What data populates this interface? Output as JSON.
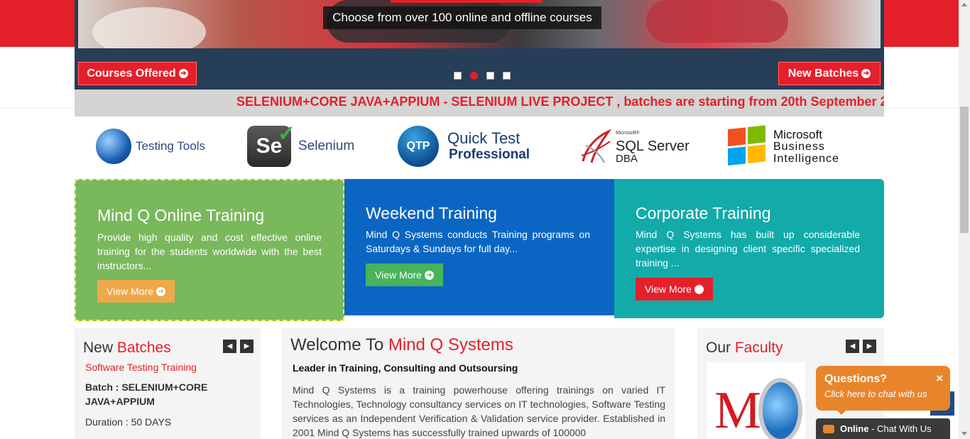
{
  "slider": {
    "caption": "Choose from over 100 online and offline courses",
    "courses_label": "Courses Offered",
    "batches_label": "New Batches",
    "dots": [
      false,
      true,
      false,
      false
    ]
  },
  "marquee": {
    "text": "SELENIUM+CORE JAVA+APPIUM - SELENIUM LIVE PROJECT , batches are starting from 20th September 2"
  },
  "logos": {
    "testing_tools": "Testing Tools",
    "selenium": "Selenium",
    "qtp_badge": "QTP",
    "qtp_line1": "Quick Test",
    "qtp_line2": "Professional",
    "sql_small": "Microsoft®",
    "sql_main": "SQL Server",
    "sql_sub": "DBA",
    "msbi_line1": "Microsoft",
    "msbi_line2": "Business",
    "msbi_line3": "Intelligence"
  },
  "features": {
    "online_title": "Mind Q Online Training",
    "online_text": "Provide high quality and cost effective online training for the students worldwide with the best instructors...",
    "online_btn": "View More",
    "weekend_title": "Weekend Training",
    "weekend_text": "Mind Q Systems conducts Training programs on Saturdays & Sundays for full day...",
    "weekend_btn": "View More",
    "corporate_title": "Corporate Training",
    "corporate_text": "Mind Q Systems has built up considerable expertise in designing client specific specialized training ...",
    "corporate_btn": "View More"
  },
  "batches": {
    "title_a": "New",
    "title_b": "Batches",
    "course": "Software Testing Training",
    "batch": "Batch : SELENIUM+CORE JAVA+APPIUM",
    "duration": "Duration : 50 DAYS"
  },
  "welcome": {
    "title_a": "Welcome To",
    "title_b": "Mind Q Systems",
    "subtitle": "Leader in Training, Consulting and Outsoursing",
    "body": "Mind Q Systems is a training powerhouse offering trainings on varied IT Technologies, Technology consultancy services on IT technologies, Software Testing services as an Independent Verification & Validation service provider. Established in 2001 Mind Q Systems has successfully trained upwards of 100000"
  },
  "faculty": {
    "title_a": "Our",
    "title_b": "Faculty",
    "logo_letter": "M"
  },
  "chat": {
    "question": "Questions?",
    "prompt": "Click here to chat with us",
    "close": "×",
    "status": "Online",
    "status_suffix": " - Chat With Us"
  },
  "colors": {
    "brand_red": "#e4202a",
    "navy": "#263e58",
    "green": "#7ab85c",
    "blue": "#0a66c2",
    "teal": "#13aaaa",
    "orange": "#e8852b"
  }
}
